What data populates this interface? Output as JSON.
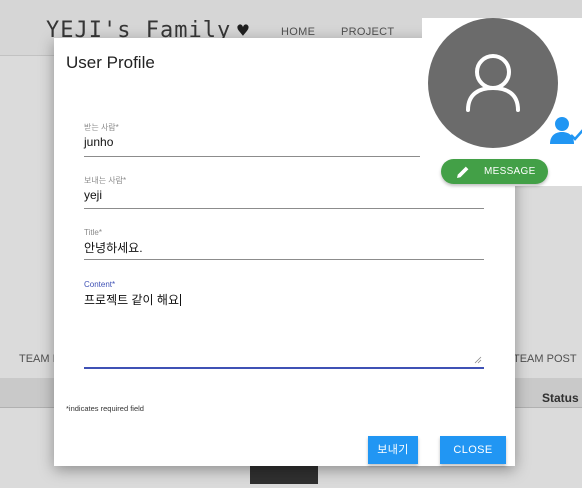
{
  "background": {
    "brand": "YEJI's Family",
    "nav": {
      "home": "HOME",
      "project": "PROJECT"
    },
    "team_left": "TEAM I",
    "team_right": "TEAM POST",
    "status_header": "Status"
  },
  "modal": {
    "title": "User Profile",
    "fields": {
      "receiver": {
        "label": "받는 사람*",
        "value": "junho"
      },
      "sender": {
        "label": "보내는 사람*",
        "value": "yeji"
      },
      "title": {
        "label": "Title*",
        "value": "안녕하세요."
      },
      "content": {
        "label": "Content*",
        "value": "프로젝트 같이 해요"
      }
    },
    "required_note": "*indicates required field",
    "send_label": "보내기",
    "close_label": "CLOSE"
  },
  "profile": {
    "message_label": "MESSAGE"
  },
  "colors": {
    "primary": "#2196f3",
    "focus": "#3f51b5",
    "message": "#43a047",
    "avatar": "#6b6b6b",
    "verified": "#2196f3"
  },
  "icons": [
    "heart-icon",
    "user-avatar-icon",
    "user-check-icon",
    "pencil-icon",
    "resize-handle-icon"
  ]
}
